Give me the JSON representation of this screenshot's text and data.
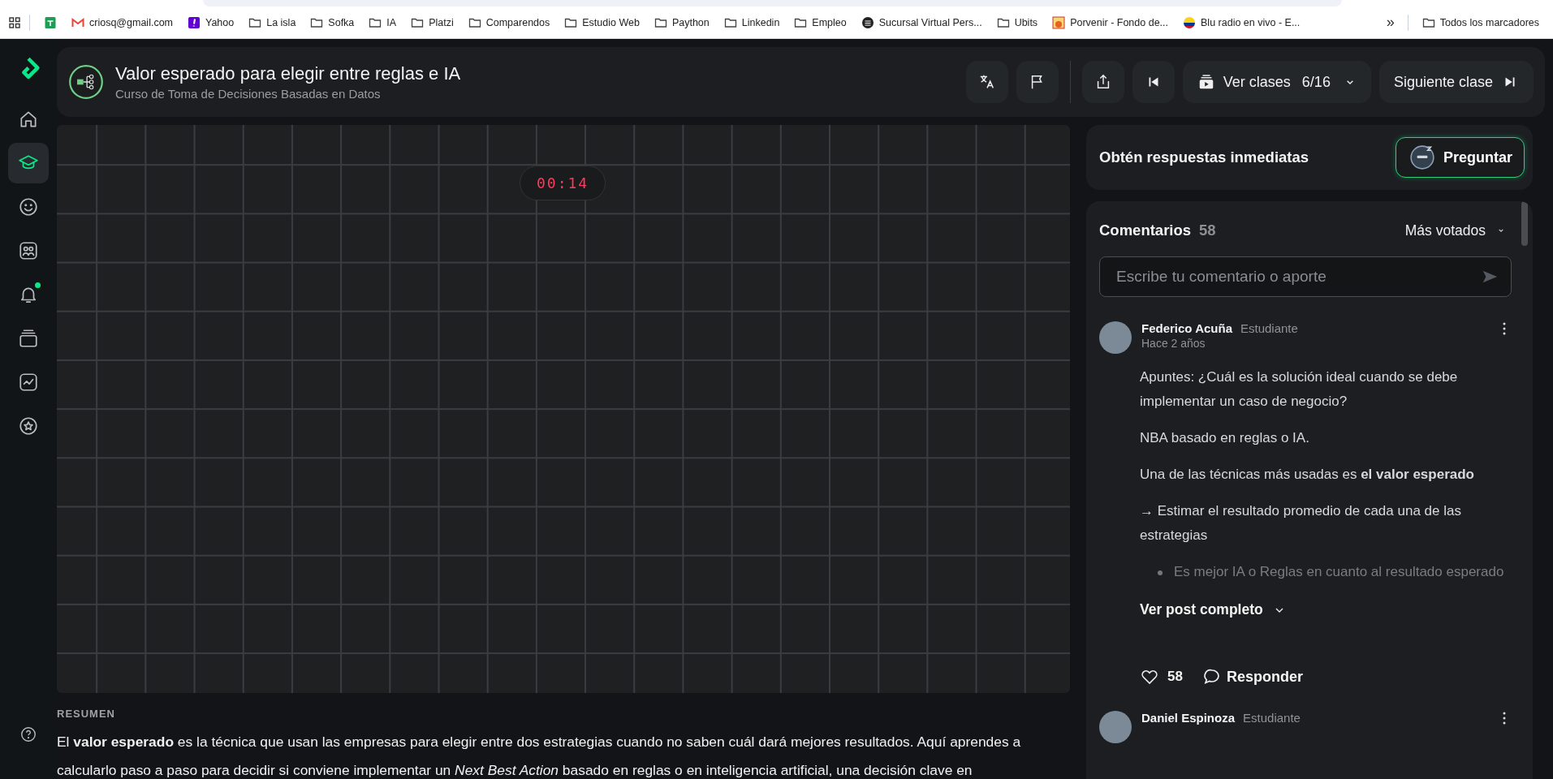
{
  "bookmarks_bar": {
    "items": [
      {
        "kind": "sheets"
      },
      {
        "kind": "gmail",
        "label": "criosq@gmail.com"
      },
      {
        "kind": "yahoo",
        "label": "Yahoo"
      },
      {
        "kind": "folder",
        "label": "La isla"
      },
      {
        "kind": "folder",
        "label": "Sofka"
      },
      {
        "kind": "folder",
        "label": "IA"
      },
      {
        "kind": "folder",
        "label": "Platzi"
      },
      {
        "kind": "folder",
        "label": "Comparendos"
      },
      {
        "kind": "folder",
        "label": "Estudio Web"
      },
      {
        "kind": "folder",
        "label": "Paython"
      },
      {
        "kind": "folder",
        "label": "Linkedin"
      },
      {
        "kind": "folder",
        "label": "Empleo"
      },
      {
        "kind": "bank",
        "label": "Sucursal Virtual Pers..."
      },
      {
        "kind": "folder",
        "label": "Ubits"
      },
      {
        "kind": "porvenir",
        "label": "Porvenir - Fondo de..."
      },
      {
        "kind": "radio",
        "label": "Blu radio en vivo - E..."
      }
    ],
    "overflow": "»",
    "all_bookmarks": "Todos los marcadores"
  },
  "sidebar": {
    "items": [
      {
        "kind": "home",
        "selected": false,
        "badge": false
      },
      {
        "kind": "courses",
        "selected": true,
        "badge": false
      },
      {
        "kind": "face",
        "selected": false,
        "badge": false
      },
      {
        "kind": "people",
        "selected": false,
        "badge": false
      },
      {
        "kind": "bell",
        "selected": false,
        "badge": true
      },
      {
        "kind": "stack",
        "selected": false,
        "badge": false
      },
      {
        "kind": "chart",
        "selected": false,
        "badge": false
      },
      {
        "kind": "star",
        "selected": false,
        "badge": false
      }
    ]
  },
  "header": {
    "title": "Valor esperado para elegir entre reglas e IA",
    "subtitle": "Curso de Toma de Decisiones Basadas en Datos",
    "classes_label": "Ver clases",
    "classes_progress": "6/16",
    "next_label": "Siguiente clase"
  },
  "video": {
    "timer": "00:14"
  },
  "summary": {
    "heading": "RESUMEN",
    "text": "El **valor esperado** es la técnica que usan las empresas para elegir entre dos estrategias cuando no saben cuál dará mejores resultados. Aquí aprendes a calcularlo paso a paso para decidir si conviene implementar un *Next Best Action* basado en reglas o en inteligencia artificial, una decisión clave en"
  },
  "ask": {
    "title": "Obtén respuestas inmediatas",
    "button": "Preguntar"
  },
  "comments": {
    "title": "Comentarios",
    "count": "58",
    "sort": "Más votados",
    "placeholder": "Escribe tu comentario o aporte",
    "items": [
      {
        "author": "Federico Acuña",
        "role": "Estudiante",
        "time": "Hace 2 años",
        "body": [
          {
            "kind": "p",
            "text": "Apuntes: ¿Cuál es la solución ideal cuando se debe implementar un caso de negocio?"
          },
          {
            "kind": "p",
            "text": "NBA basado en reglas o IA."
          },
          {
            "kind": "p",
            "text": "Una de las técnicas más usadas es **el valor esperado**"
          },
          {
            "kind": "p",
            "text": "→ Estimar el resultado promedio de cada una de las estrategias"
          },
          {
            "kind": "bullet",
            "text": "Es mejor IA o Reglas en cuanto al resultado esperado"
          }
        ],
        "expand": "Ver post completo",
        "likes": "58",
        "reply": "Responder"
      },
      {
        "author": "Daniel Espinoza",
        "role": "Estudiante"
      }
    ]
  }
}
